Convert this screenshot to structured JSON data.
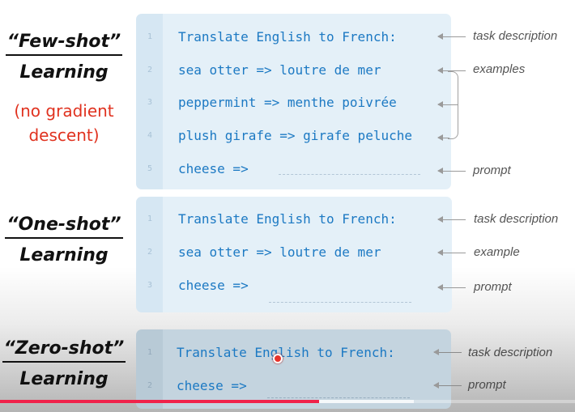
{
  "sections": [
    {
      "heading1": "“Few-shot”",
      "heading2": "Learning",
      "note1": "(no gradient",
      "note2": "descent)",
      "lines": [
        {
          "num": "1",
          "text": "Translate English to French:"
        },
        {
          "num": "2",
          "text": "sea otter => loutre de mer"
        },
        {
          "num": "3",
          "text": "peppermint => menthe poivrée"
        },
        {
          "num": "4",
          "text": "plush girafe => girafe peluche"
        },
        {
          "num": "5",
          "text": "cheese =>"
        }
      ],
      "labels": {
        "task": "task description",
        "examples": "examples",
        "prompt": "prompt"
      }
    },
    {
      "heading1": "“One-shot”",
      "heading2": "Learning",
      "lines": [
        {
          "num": "1",
          "text": "Translate English to French:"
        },
        {
          "num": "2",
          "text": "sea otter => loutre de mer"
        },
        {
          "num": "3",
          "text": "cheese =>"
        }
      ],
      "labels": {
        "task": "task description",
        "example": "example",
        "prompt": "prompt"
      }
    },
    {
      "heading1": "“Zero-shot”",
      "heading2": "Learning",
      "lines": [
        {
          "num": "1",
          "text": "Translate English to French:"
        },
        {
          "num": "2",
          "text": "cheese =>"
        }
      ],
      "labels": {
        "task": "task description",
        "prompt": "prompt"
      }
    }
  ],
  "video": {
    "played_fraction": 0.555,
    "buffered_fraction": 0.72,
    "played_color": "#f0224a"
  },
  "colors": {
    "code": "#1c79c3",
    "note": "#e0321f",
    "panel": "#e4f0f8"
  }
}
